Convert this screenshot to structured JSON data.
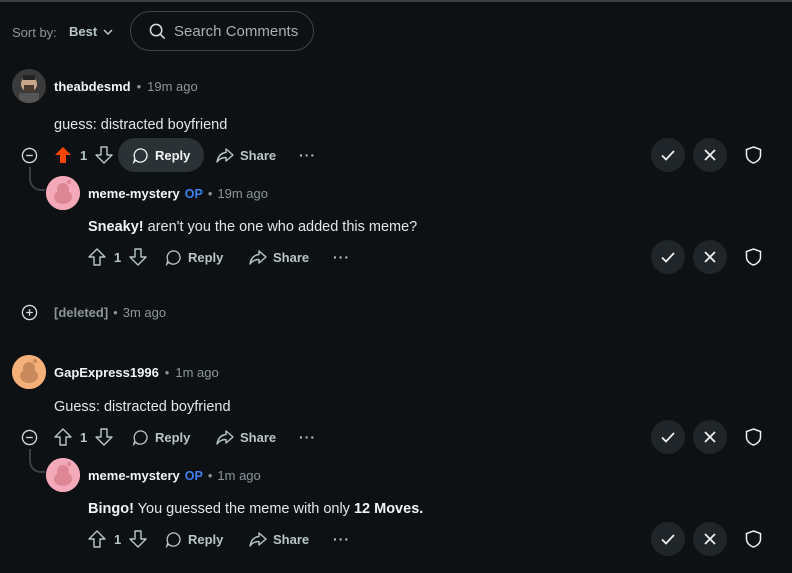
{
  "sort": {
    "label": "Sort by:",
    "value": "Best"
  },
  "search": {
    "placeholder": "Search Comments"
  },
  "comments": [
    {
      "username": "theabdesmd",
      "time": "19m ago",
      "text": "guess: distracted boyfriend",
      "votes": "1",
      "upvoted": true,
      "reply_label": "Reply",
      "share_label": "Share",
      "reply": {
        "username": "meme-mystery",
        "op": "OP",
        "time": "19m ago",
        "bold": "Sneaky!",
        "text": " aren't you the one who added this meme?",
        "votes": "1",
        "reply_label": "Reply",
        "share_label": "Share"
      }
    },
    {
      "username": "[deleted]",
      "time": "3m ago"
    },
    {
      "username": "GapExpress1996",
      "time": "1m ago",
      "text": "Guess: distracted boyfriend",
      "votes": "1",
      "reply_label": "Reply",
      "share_label": "Share",
      "reply": {
        "username": "meme-mystery",
        "op": "OP",
        "time": "1m ago",
        "bold": "Bingo!",
        "text": " You guessed the meme with only ",
        "bold2": "12 Moves.",
        "votes": "1",
        "reply_label": "Reply",
        "share_label": "Share"
      }
    }
  ],
  "colors": {
    "upvote_active": "#ff4500",
    "op_blue": "#3f7ff0",
    "background": "#0e1113"
  }
}
